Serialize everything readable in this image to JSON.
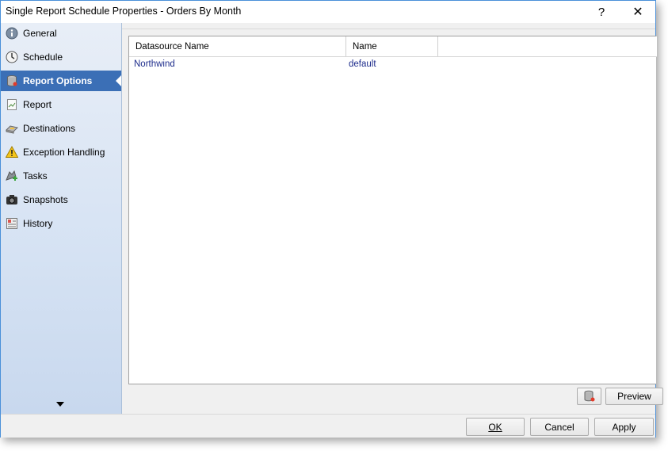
{
  "window": {
    "title": "Single Report Schedule Properties - Orders By Month",
    "help_label": "?",
    "close_label": "✕"
  },
  "sidebar": {
    "items": [
      {
        "label": "General",
        "icon": "info-icon"
      },
      {
        "label": "Schedule",
        "icon": "clock-icon"
      },
      {
        "label": "Report Options",
        "icon": "database-icon",
        "active": true
      },
      {
        "label": "Report",
        "icon": "report-icon"
      },
      {
        "label": "Destinations",
        "icon": "destinations-icon"
      },
      {
        "label": "Exception Handling",
        "icon": "warning-icon"
      },
      {
        "label": "Tasks",
        "icon": "tasks-icon"
      },
      {
        "label": "Snapshots",
        "icon": "camera-icon"
      },
      {
        "label": "History",
        "icon": "history-icon"
      }
    ]
  },
  "grid": {
    "columns": [
      "Datasource Name",
      "Name"
    ],
    "rows": [
      {
        "datasource": "Northwind",
        "name": "default"
      }
    ]
  },
  "actions": {
    "preview_label": "Preview"
  },
  "footer": {
    "ok_label": "OK",
    "cancel_label": "Cancel",
    "apply_label": "Apply"
  },
  "colors": {
    "accent": "#3b6fb6",
    "link_text": "#1e2d8c"
  }
}
